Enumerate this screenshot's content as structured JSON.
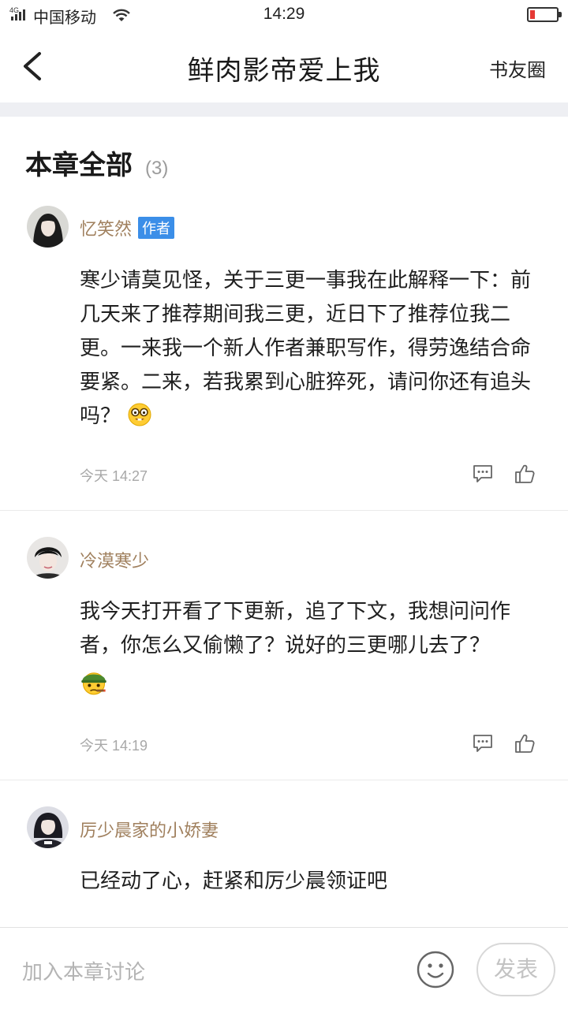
{
  "status_bar": {
    "network": "4G",
    "carrier": "中国移动",
    "time": "14:29"
  },
  "nav": {
    "title": "鲜肉影帝爱上我",
    "right_label": "书友圈"
  },
  "section": {
    "title": "本章全部",
    "count": "(3)"
  },
  "comments": [
    {
      "username": "忆笑然",
      "badge": "作者",
      "text": "寒少请莫见怪，关于三更一事我在此解释一下：前几天来了推荐期间我三更，近日下了推荐位我二更。一来我一个新人作者兼职写作，得劳逸结合命要紧。二来，若我累到心脏猝死，请问你还有追头吗？",
      "emoji": "nerd-face-emoji",
      "time": "今天 14:27"
    },
    {
      "username": "冷漠寒少",
      "text": "我今天打开看了下更新，追了下文，我想问问作者，你怎么又偷懒了？说好的三更哪儿去了？",
      "emoji": "soldier-helmet-cigar-emoji",
      "time": "今天 14:19"
    },
    {
      "username": "厉少晨家的小娇妻",
      "text": "已经动了心，赶紧和厉少晨领证吧"
    }
  ],
  "input_bar": {
    "placeholder": "加入本章讨论",
    "send_label": "发表"
  },
  "colors": {
    "username": "#a0805e",
    "author_badge": "#3b8ee8",
    "battery_low": "#e53935"
  }
}
